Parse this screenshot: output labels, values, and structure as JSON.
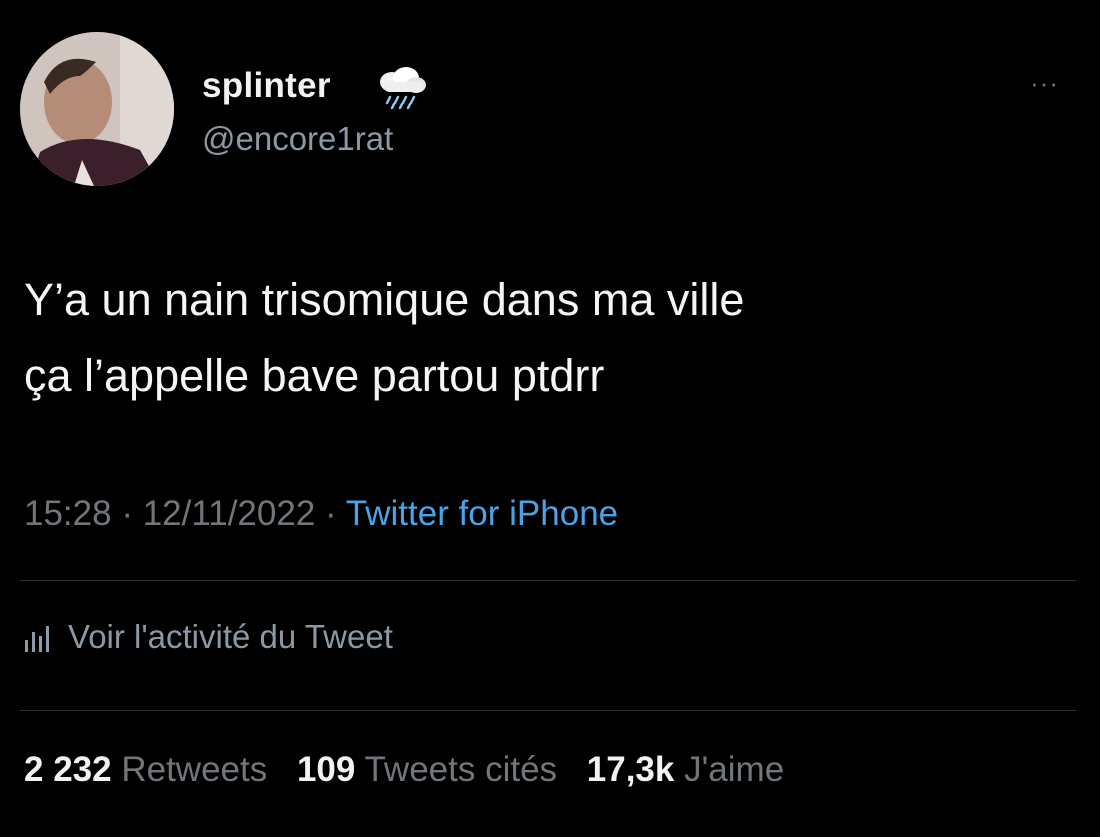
{
  "author": {
    "display_name": "splinter",
    "emoji": "cloud-with-rain-icon",
    "handle": "@encore1rat"
  },
  "tweet": {
    "text_line1": "Y’a un nain trisomique dans ma ville",
    "text_line2": "ça l’appelle bave partou ptdrr",
    "time": "15:28",
    "separator": "·",
    "date": "12/11/2022",
    "source": "Twitter for iPhone"
  },
  "more_label": "···",
  "activity": {
    "icon": "bar-chart-icon",
    "label": "Voir l'activité du Tweet"
  },
  "stats": {
    "retweets_count": "2 232",
    "retweets_label": "Retweets",
    "quotes_count": "109",
    "quotes_label": "Tweets cités",
    "likes_count": "17,3k",
    "likes_label": "J'aime"
  },
  "colors": {
    "background": "#000000",
    "text": "#e7e9ea",
    "secondary": "#71767b",
    "link": "#4aa3e6",
    "divider": "#2f3336"
  }
}
